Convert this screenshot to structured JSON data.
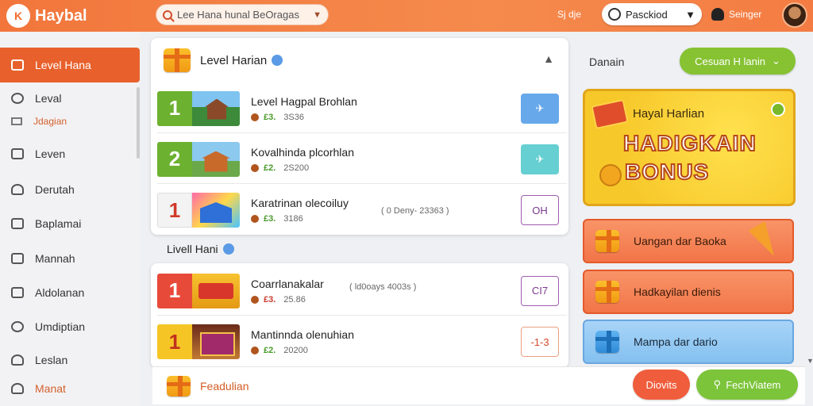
{
  "app": {
    "logo_mark": "K",
    "name": "Haybal"
  },
  "search": {
    "value": "Lee Hana hunal BeOragas"
  },
  "topbar": {
    "sign_link": "Sj dje",
    "language": "Pasckiod",
    "user_label": "Seinger"
  },
  "sidebar": {
    "items": [
      {
        "label": "Level Hana",
        "icon": "gift-icon"
      },
      {
        "label": "Leval",
        "icon": "time-icon"
      },
      {
        "label": "Leven",
        "icon": "list-icon"
      },
      {
        "label": "Derutah",
        "icon": "user-icon"
      },
      {
        "label": "Baplamai",
        "icon": "lock-icon"
      },
      {
        "label": "Mannah",
        "icon": "calendar-icon"
      },
      {
        "label": "Aldolanan",
        "icon": "edit-icon"
      },
      {
        "label": "Umdiptian",
        "icon": "gear-icon"
      },
      {
        "label": "Leslan",
        "icon": "users-icon"
      },
      {
        "label": "Manat",
        "icon": "user-icon"
      }
    ],
    "sub_item": "Jdagian"
  },
  "daily_section": {
    "title": "Level Harian",
    "rows": [
      {
        "rank": "1",
        "name": "Level Hagpal Brohlan",
        "points": "£3.",
        "amount": "3S36",
        "action": "✈",
        "rank_color": "#6cb12f",
        "btn": "btn-blue"
      },
      {
        "rank": "2",
        "name": "Kovalhinda plcorhlan",
        "points": "£2.",
        "amount": "2S200",
        "action": "✈",
        "rank_color": "#6cb12f",
        "btn": "btn-teal"
      },
      {
        "rank": "1",
        "name": "Karatrinan olecoiluy",
        "points": "£3.",
        "amount": "3186",
        "note": "( 0 Deny- 23363 )",
        "action": "OH",
        "rank_color": "#f3f3f3",
        "btn": "btn-outline-purple"
      }
    ]
  },
  "level_section": {
    "title": "Livell Hani",
    "rows": [
      {
        "rank": "1",
        "name": "Coarrlanakalar",
        "points": "£3.",
        "amount": "25.86",
        "note": "( ld0oays 4003s )",
        "action": "CI7",
        "rank_color": "#e84a3a",
        "btn": "btn-outline-purple"
      },
      {
        "rank": "1",
        "name": "Mantinnda olenuhian",
        "points": "£2.",
        "amount": "20200",
        "action": "-1-3",
        "rank_color": "#f5c526",
        "btn": "btn-outline-red"
      }
    ]
  },
  "footer": {
    "label": "Feadulian",
    "btn_orange": "Diovits",
    "btn_green": "FechViatem"
  },
  "right_panel": {
    "title": "Danain",
    "dropdown": "Cesuan H lanin",
    "promo": {
      "subtitle": "Hayal Harlian",
      "title_line1": "HADIGKAIN",
      "title_line2": "BONUS",
      "tag": "BONUS"
    },
    "buttons": [
      {
        "label": "Uangan dar Baoka",
        "style": "r-orange"
      },
      {
        "label": "Hadkayilan dienis",
        "style": "r-orange"
      },
      {
        "label": "Mampa dar dario",
        "style": "r-blue"
      }
    ]
  },
  "colors": {
    "brand": "#f2763c",
    "accent_green": "#7cc43a",
    "accent_blue": "#67a8ea"
  }
}
